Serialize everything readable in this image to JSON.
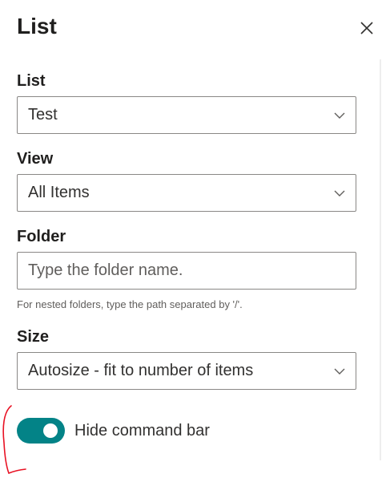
{
  "panel": {
    "title": "List",
    "close_icon": "close-icon"
  },
  "fields": {
    "list": {
      "label": "List",
      "value": "Test",
      "icon": "chevron-down-icon"
    },
    "view": {
      "label": "View",
      "value": "All Items",
      "icon": "chevron-down-icon"
    },
    "folder": {
      "label": "Folder",
      "value": "",
      "placeholder": "Type the folder name.",
      "helper": "For nested folders, type the path separated by '/'."
    },
    "size": {
      "label": "Size",
      "value": "Autosize - fit to number of items",
      "icon": "chevron-down-icon"
    }
  },
  "toggle": {
    "label": "Hide command bar",
    "checked": true,
    "color": "#038387"
  },
  "colors": {
    "accent": "#038387",
    "annotation": "#e81123",
    "border": "#8a8886",
    "text": "#323130"
  }
}
